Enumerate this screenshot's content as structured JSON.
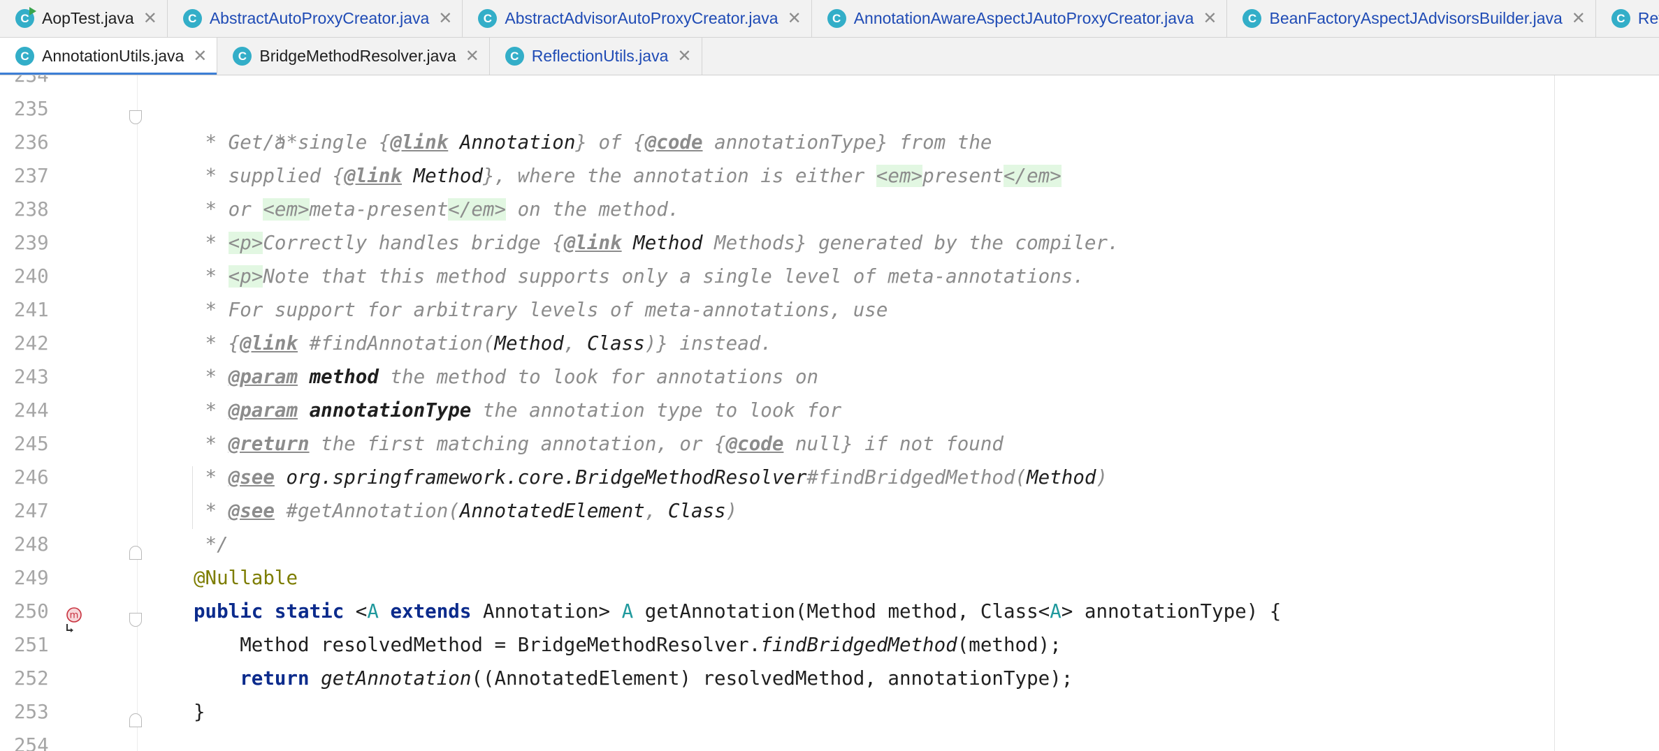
{
  "tabs_row1": [
    {
      "label": "AopTest.java",
      "icon": "class-icon-runnable",
      "color": "#1f1f1f"
    },
    {
      "label": "AbstractAutoProxyCreator.java",
      "icon": "class-icon",
      "color": "#1f4bb5"
    },
    {
      "label": "AbstractAdvisorAutoProxyCreator.java",
      "icon": "class-icon",
      "color": "#1f4bb5"
    },
    {
      "label": "AnnotationAwareAspectJAutoProxyCreator.java",
      "icon": "class-icon",
      "color": "#1f4bb5"
    },
    {
      "label": "BeanFactoryAspectJAdvisorsBuilder.java",
      "icon": "class-icon",
      "color": "#1f4bb5"
    },
    {
      "label": "Reflective",
      "icon": "class-icon",
      "color": "#1f4bb5"
    }
  ],
  "tabs_row2": [
    {
      "label": "AnnotationUtils.java",
      "icon": "class-icon",
      "active": true
    },
    {
      "label": "BridgeMethodResolver.java",
      "icon": "class-icon",
      "color": "#1f1f1f"
    },
    {
      "label": "ReflectionUtils.java",
      "icon": "class-icon",
      "color": "#1f4bb5"
    }
  ],
  "editor": {
    "line_numbers": [
      "234",
      "235",
      "236",
      "237",
      "238",
      "239",
      "240",
      "241",
      "242",
      "243",
      "244",
      "245",
      "246",
      "247",
      "248",
      "249",
      "250",
      "251",
      "252",
      "253",
      "254"
    ],
    "code": {
      "l235": "/**",
      "l236": [
        " * Get a single {",
        "@link",
        " Annotation",
        "} of {",
        "@code",
        " annotationType} from the"
      ],
      "l237": [
        " * supplied {",
        "@link",
        " Method",
        "}, where the annotation is either ",
        "<em>",
        "present",
        "</em>"
      ],
      "l238": [
        " * or ",
        "<em>",
        "meta-present",
        "</em>",
        " on the method."
      ],
      "l239": [
        " * ",
        "<p>",
        "Correctly handles bridge {",
        "@link",
        " Method",
        " Methods} generated by the compiler."
      ],
      "l240": [
        " * ",
        "<p>",
        "Note that this method supports only a single level of meta-annotations."
      ],
      "l241": " * For support for arbitrary levels of meta-annotations, use",
      "l242": [
        " * {",
        "@link",
        " #findAnnotation(",
        "Method",
        ", ",
        "Class",
        ")} instead."
      ],
      "l243": [
        " * ",
        "@param",
        " ",
        "method",
        " the method to look for annotations on"
      ],
      "l244": [
        " * ",
        "@param",
        " ",
        "annotationType",
        " the annotation type to look for"
      ],
      "l245": [
        " * ",
        "@return",
        " the first matching annotation, or {",
        "@code",
        " null} if not found"
      ],
      "l246": [
        " * ",
        "@see",
        " ",
        "org.springframework.core.BridgeMethodResolver",
        "#findBridgedMethod(",
        "Method",
        ")"
      ],
      "l247": [
        " * ",
        "@see",
        " #getAnnotation(",
        "AnnotatedElement",
        ", ",
        "Class",
        ")"
      ],
      "l248": " */",
      "l249": "@Nullable",
      "l250": [
        "public",
        " ",
        "static",
        " <",
        "A",
        " ",
        "extends",
        " Annotation> ",
        "A",
        " getAnnotation(Method method, Class<",
        "A",
        "> annotationType) {"
      ],
      "l251": [
        "    Method resolvedMethod = BridgeMethodResolver.",
        "findBridgedMethod",
        "(method);"
      ],
      "l252": [
        "    ",
        "return",
        " ",
        "getAnnotation",
        "((AnnotatedElement) resolvedMethod, annotationType);"
      ],
      "l253": "}"
    },
    "gutter_markers": {
      "override_icon": "method-override-icon",
      "override_letter": "m"
    }
  }
}
